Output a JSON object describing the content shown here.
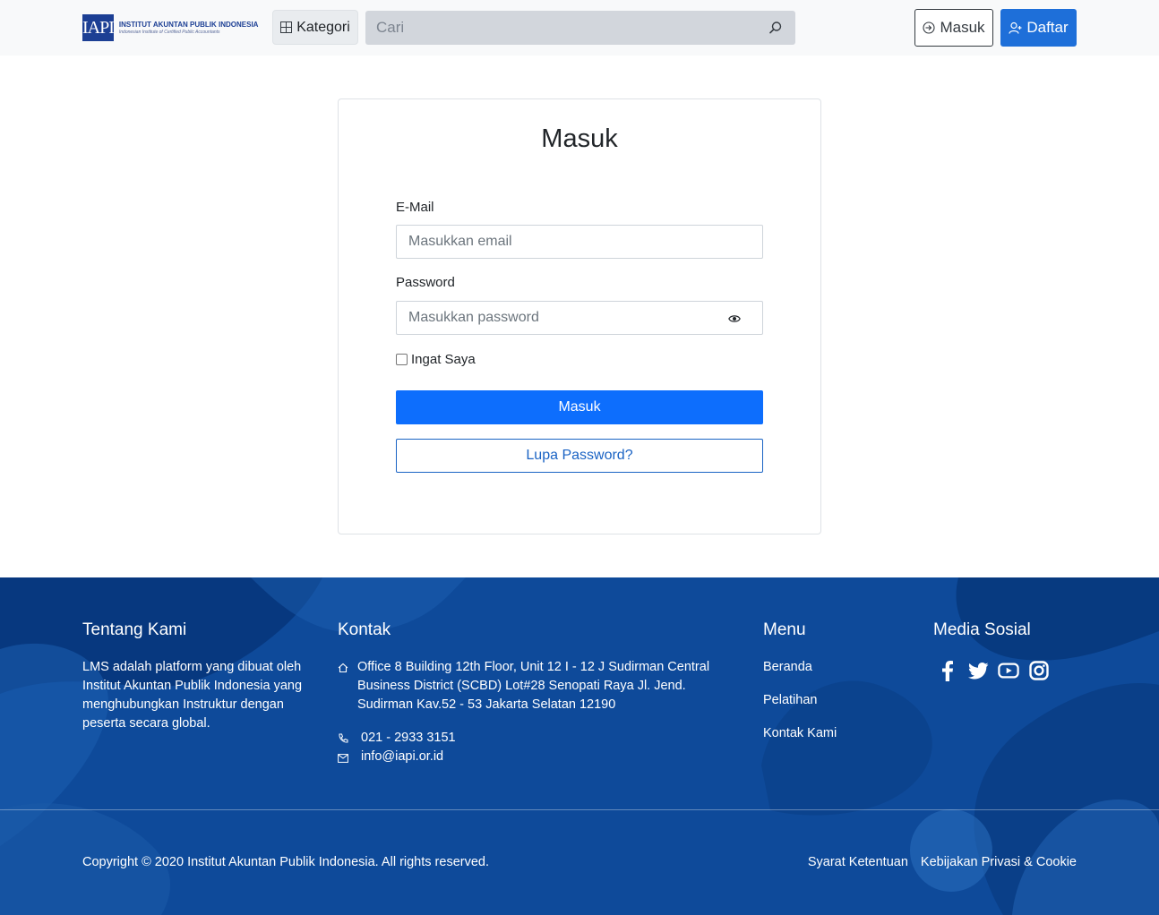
{
  "header": {
    "logo_mark": "IAPI",
    "logo_title": "INSTITUT AKUNTAN PUBLIK INDONESIA",
    "logo_subtitle": "Indonesian Institute of Certified Public Accountants",
    "kategori_label": "Kategori",
    "kategori_icon": "grid-icon",
    "search_placeholder": "Cari",
    "search_icon": "search-icon",
    "login_label": "Masuk",
    "login_icon": "sign-in-icon",
    "register_label": "Daftar",
    "register_icon": "user-plus-icon"
  },
  "login_card": {
    "title": "Masuk",
    "email_label": "E-Mail",
    "email_placeholder": "Masukkan email",
    "email_value": "",
    "password_label": "Password",
    "password_placeholder": "Masukkan password",
    "password_value": "",
    "remember_label": "Ingat Saya",
    "remember_checked": false,
    "submit_label": "Masuk",
    "forgot_label": "Lupa Password?"
  },
  "footer": {
    "about_heading": "Tentang Kami",
    "about_text": "LMS adalah platform yang dibuat oleh Institut Akuntan Publik Indonesia yang menghubungkan Instruktur dengan peserta secara global.",
    "contact_heading": "Kontak",
    "address": "Office 8 Building 12th Floor, Unit 12 I - 12 J Sudirman Central Business District (SCBD) Lot#28 Senopati Raya Jl. Jend. Sudirman Kav.52 - 53 Jakarta Selatan 12190",
    "phone": "021 - 2933 3151",
    "email": "info@iapi.or.id",
    "menu_heading": "Menu",
    "menu_items": [
      "Beranda",
      "Pelatihan",
      "Kontak Kami"
    ],
    "social_heading": "Media Sosial",
    "social_icons": [
      "facebook-icon",
      "twitter-icon",
      "youtube-icon",
      "instagram-icon"
    ],
    "copyright": "Copyright © 2020 Institut Akuntan Publik Indonesia. All rights reserved.",
    "terms_label": "Syarat Ketentuan",
    "privacy_label": "Kebijakan Privasi & Cookie"
  },
  "colors": {
    "primary": "#0d6efd",
    "register_button": "#1e6fd9",
    "footer_background": "#0e4a9a",
    "navbar_background": "#f8f9fa"
  }
}
